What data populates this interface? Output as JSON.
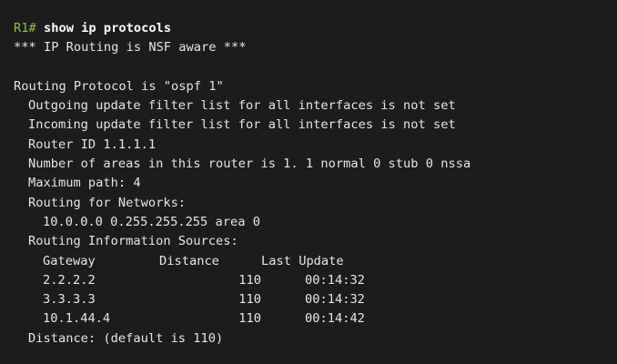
{
  "prompt": "R1#",
  "command": "show ip protocols",
  "nsf": "*** IP Routing is NSF aware ***",
  "protocol_line": "Routing Protocol is \"ospf 1\"",
  "outgoing": "Outgoing update filter list for all interfaces is not set",
  "incoming": "Incoming update filter list for all interfaces is not set",
  "router_id": "Router ID 1.1.1.1",
  "areas": "Number of areas in this router is 1. 1 normal 0 stub 0 nssa",
  "max_path": "Maximum path: 4",
  "routing_for_networks": "Routing for Networks:",
  "network_entry": "10.0.0.0 0.255.255.255 area 0",
  "info_sources": "Routing Information Sources:",
  "sources_header": {
    "gateway": "Gateway",
    "distance": "Distance",
    "last_update": "Last Update"
  },
  "sources": [
    {
      "gateway": "2.2.2.2",
      "distance": "110",
      "last_update": "00:14:32"
    },
    {
      "gateway": "3.3.3.3",
      "distance": "110",
      "last_update": "00:14:32"
    },
    {
      "gateway": "10.1.44.4",
      "distance": "110",
      "last_update": "00:14:42"
    }
  ],
  "distance_line": "Distance: (default is 110)",
  "colors": {
    "background": "#1c1c1c",
    "text": "#e6e6e6",
    "prompt": "#8ec23f",
    "command": "#ffffff"
  }
}
